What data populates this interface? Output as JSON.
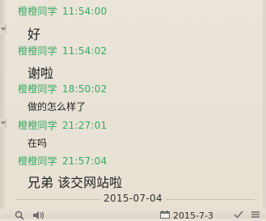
{
  "messages": [
    {
      "sender": "橙橙同学",
      "time": "11:54:00",
      "text": "好"
    },
    {
      "sender": "橙橙同学",
      "time": "11:54:02",
      "text": "谢啦"
    },
    {
      "sender": "橙橙同学",
      "time": "18:50:02",
      "text": "做的怎么样了"
    },
    {
      "sender": "橙橙同学",
      "time": "21:27:01",
      "text": "在吗"
    },
    {
      "sender": "橙橙同学",
      "time": "21:57:04",
      "text": "兄弟 该交网站啦"
    }
  ],
  "date_divider": "2015-07-04",
  "bottom_bar": {
    "date_label": "2015-7-3"
  },
  "icons": [
    "search-icon",
    "sound-icon",
    "calendar-icon",
    "check-icon",
    "more-icon"
  ],
  "colors": {
    "sender": "#3aa860",
    "background": "#e8e2d6",
    "text": "#1f1f1f"
  }
}
